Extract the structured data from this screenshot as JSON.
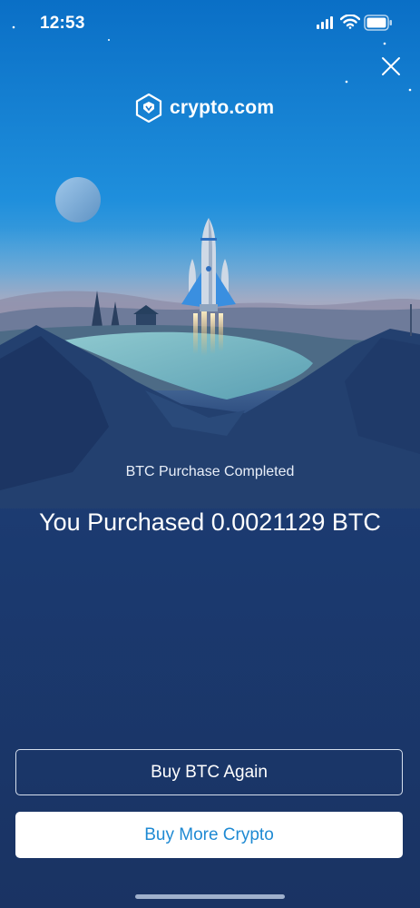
{
  "status_bar": {
    "time": "12:53"
  },
  "brand": {
    "logo_text": "crypto.com"
  },
  "purchase": {
    "status": "BTC Purchase Completed",
    "headline": "You Purchased 0.0021129 BTC"
  },
  "actions": {
    "buy_again_label": "Buy BTC Again",
    "buy_more_label": "Buy More Crypto"
  },
  "icons": {
    "close": "close-icon",
    "signal": "cellular-signal-icon",
    "wifi": "wifi-icon",
    "battery": "battery-icon"
  },
  "colors": {
    "sky_top": "#0a6fc6",
    "background_bottom": "#1a3363",
    "primary_button_text": "#1f8ad3"
  }
}
